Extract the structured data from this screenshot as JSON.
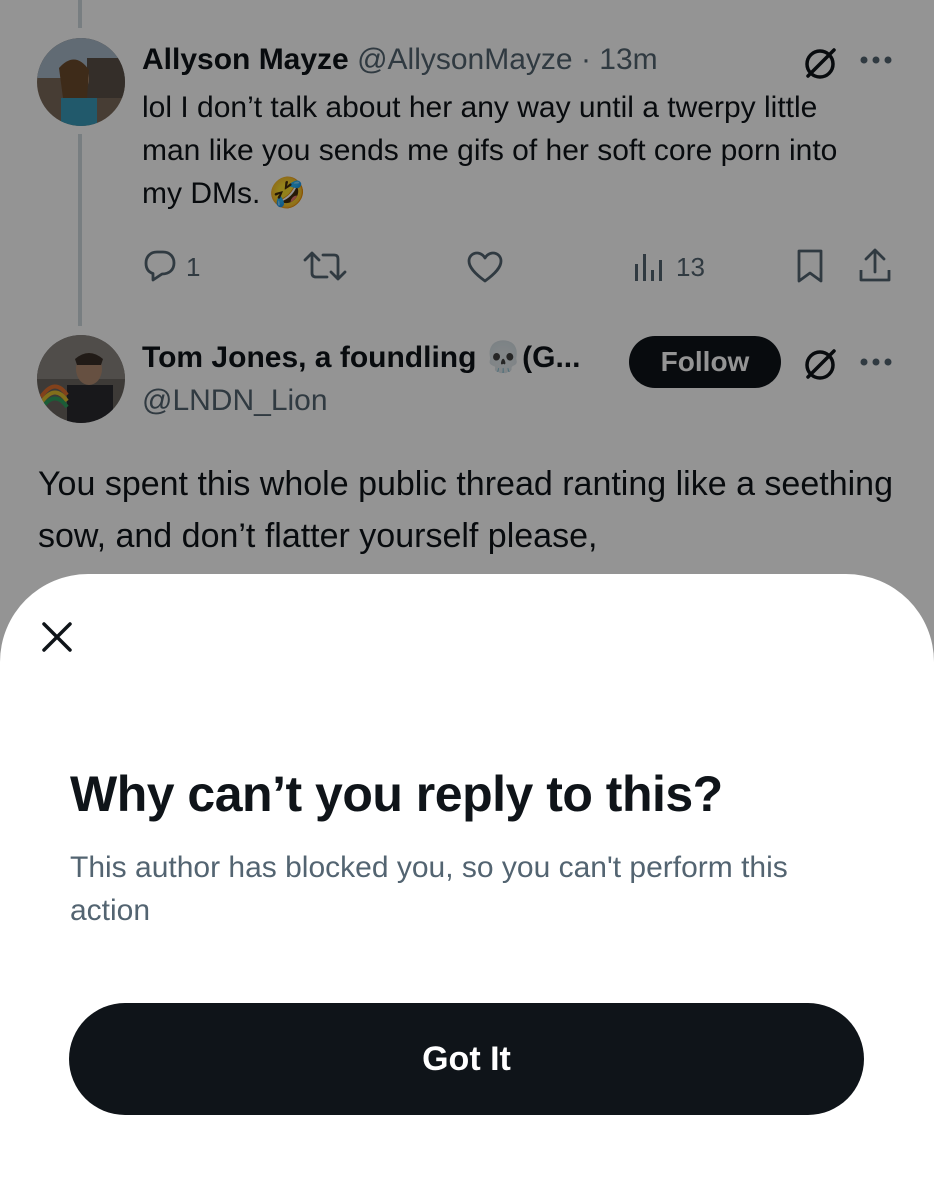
{
  "tweet1": {
    "name": "Allyson Mayze",
    "handle": "@AllysonMayze",
    "separator": "·",
    "time": "13m",
    "text": "lol I don’t talk about her any way until a twerpy little man like you sends me gifs of her soft core porn into my DMs. 🤣",
    "reply_count": "1",
    "view_count": "13"
  },
  "tweet2": {
    "name": "Tom Jones, a foundling 💀(G...",
    "handle": "@LNDN_Lion",
    "follow_label": "Follow",
    "text": "You spent this whole public thread ranting like a seething sow, and don’t flatter yourself please,"
  },
  "sheet": {
    "title": "Why can’t you reply to this?",
    "description": "This author has blocked you, so you can't perform this action",
    "button_label": "Got It"
  },
  "colors": {
    "text_primary": "#0f1419",
    "text_secondary": "#536471",
    "button_bg": "#0f1419"
  },
  "icons": [
    "no-reply-icon",
    "more-icon",
    "reply-icon",
    "retweet-icon",
    "like-icon",
    "views-icon",
    "bookmark-icon",
    "share-icon",
    "close-icon"
  ]
}
